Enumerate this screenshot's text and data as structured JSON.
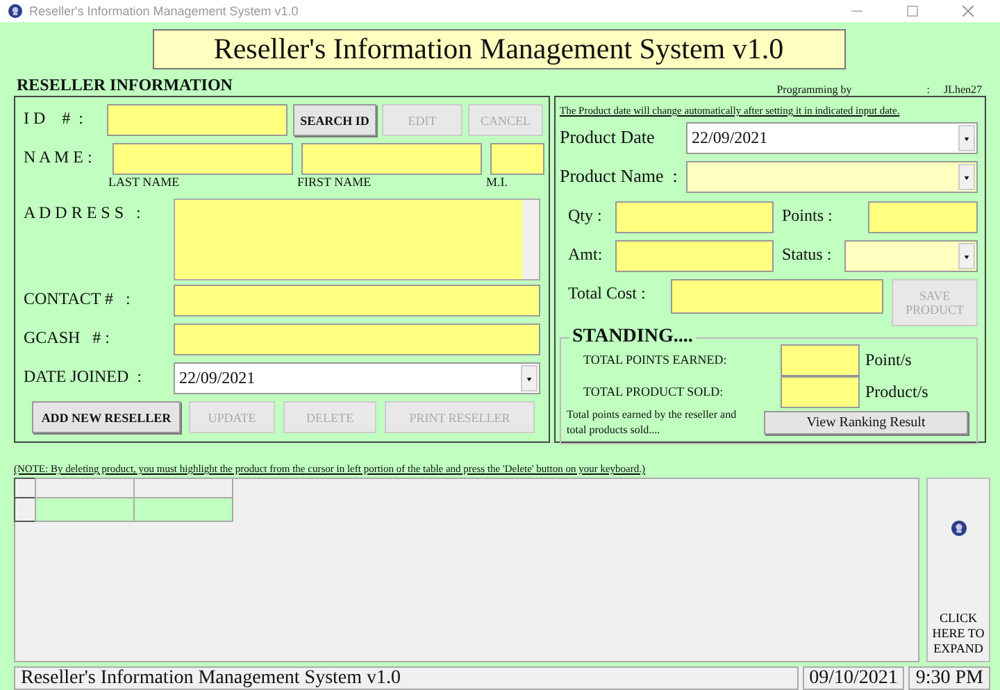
{
  "window": {
    "title": "Reseller's Information Management System v1.0"
  },
  "header": {
    "title": "Reseller's Information Management System v1.0"
  },
  "section_title": "RESELLER INFORMATION",
  "credit": {
    "label": "Programming by",
    "separator": ":",
    "author": "JLhen27"
  },
  "reseller": {
    "id_label": "I D    #  :",
    "id_buttons": [
      {
        "label": "SEARCH ID",
        "disabled": false
      },
      {
        "label": "EDIT",
        "disabled": true
      },
      {
        "label": "CANCEL",
        "disabled": true
      }
    ],
    "name_label": "N A M E :",
    "name_parts": [
      "LAST NAME",
      "FIRST NAME",
      "M.I."
    ],
    "address_label": "A D D R E S S   :",
    "contact_label": "CONTACT #   :",
    "gcash_label": "GCASH   # :",
    "date_joined": {
      "label": "DATE JOINED  :",
      "value": "22/09/2021"
    },
    "actions": [
      {
        "label": "ADD NEW RESELLER",
        "disabled": false
      },
      {
        "label": "UPDATE",
        "disabled": true
      },
      {
        "label": "DELETE",
        "disabled": true
      },
      {
        "label": "PRINT RESELLER",
        "disabled": true
      }
    ]
  },
  "product": {
    "note": "The Product date will change automatically after setting it in indicated input date.",
    "date": {
      "label": "Product Date",
      "value": "22/09/2021"
    },
    "name_label": "Product Name  :",
    "qty_label": "Qty :",
    "points_label": "Points :",
    "amt_label": "Amt:",
    "status_label": "Status :",
    "total_label": "Total Cost :",
    "save_button": {
      "label": "SAVE PRODUCT",
      "disabled": true
    },
    "standing": {
      "title": "STANDING....",
      "rows": [
        {
          "label": "TOTAL POINTS EARNED:",
          "unit": "Point/s"
        },
        {
          "label": "TOTAL PRODUCT SOLD:",
          "unit": "Product/s"
        }
      ],
      "caption": "Total points earned by the reseller and total products sold....",
      "button": {
        "label": "View Ranking Result",
        "disabled": false
      }
    }
  },
  "note": "(NOTE: By deleting product, you must highlight the product from the cursor in left portion of the table and press the 'Delete' button on your keyboard.)",
  "expand_button": "CLICK HERE TO EXPAND",
  "status_bar": {
    "title": "Reseller's Information Management System v1.0",
    "date": "09/10/2021",
    "time": "9:30 PM"
  }
}
